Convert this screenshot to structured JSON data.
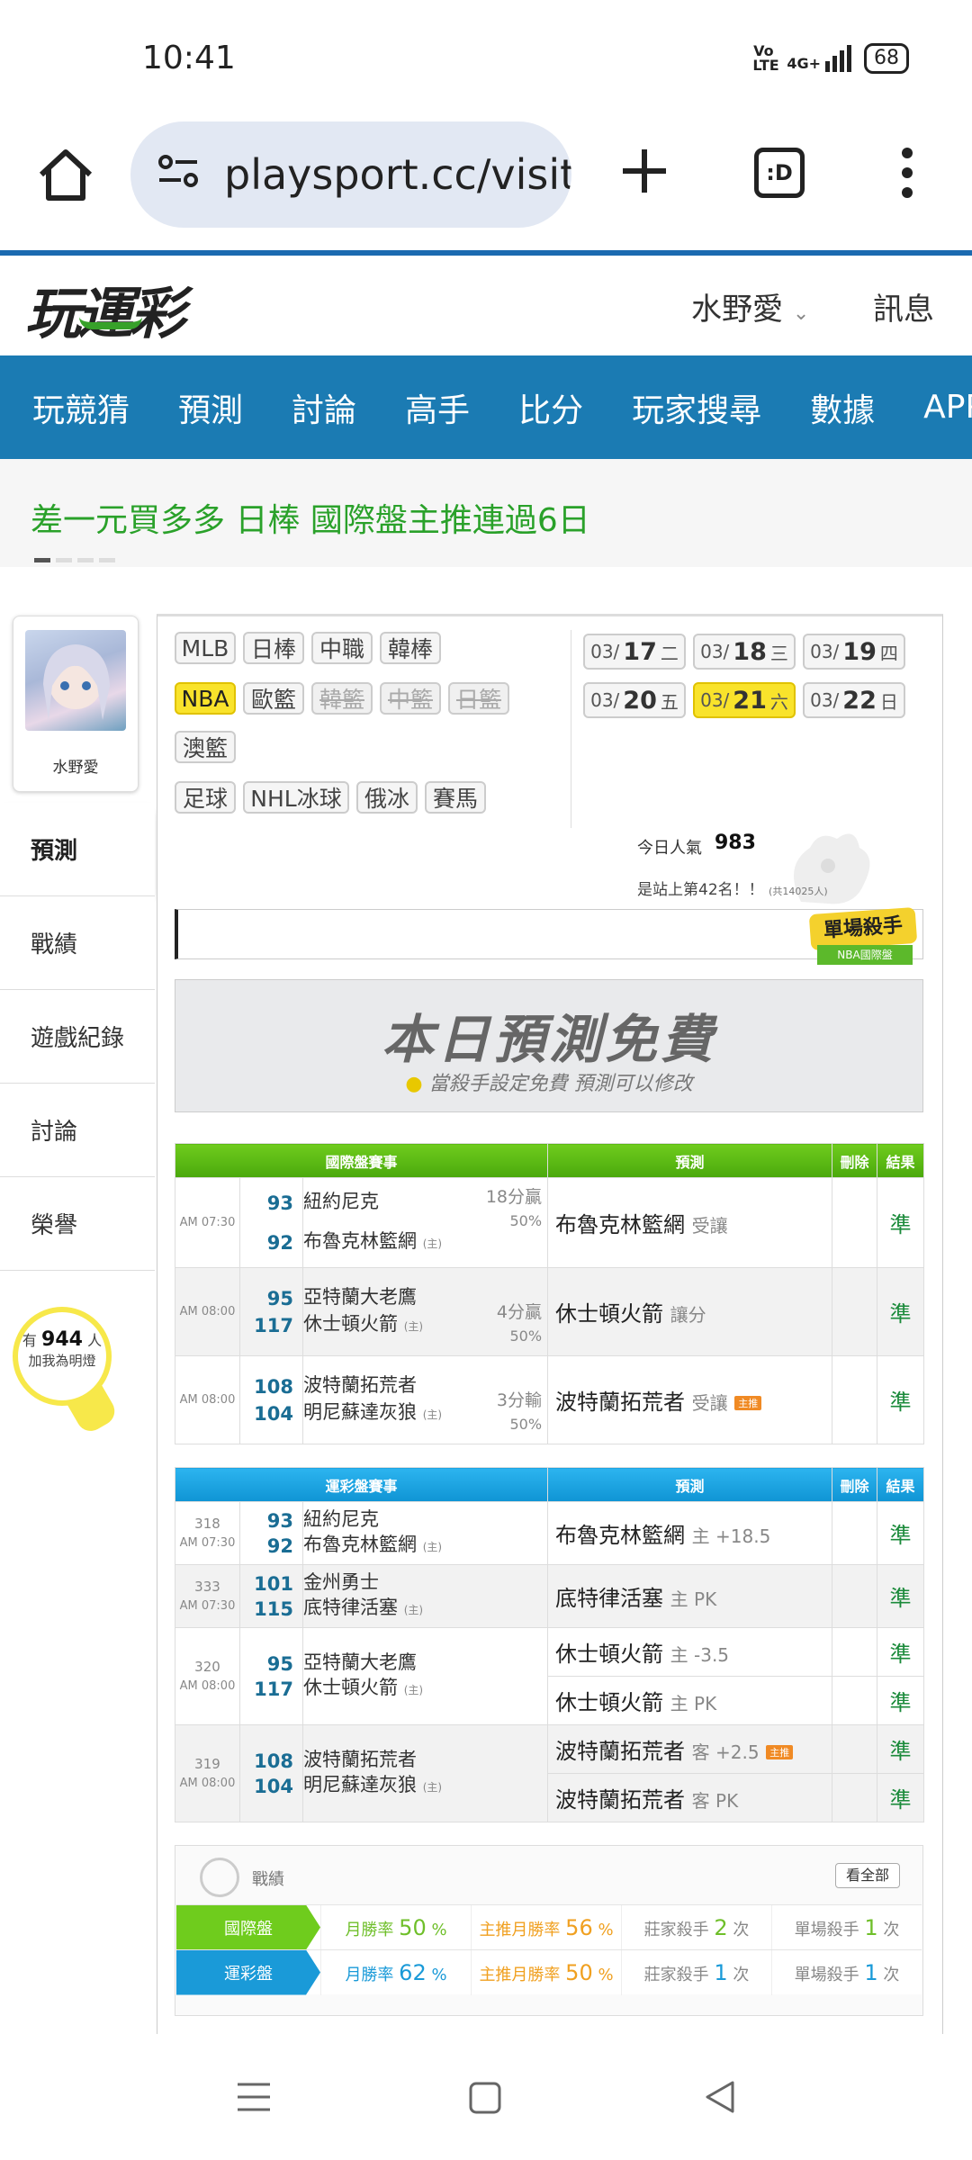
{
  "status_bar": {
    "time": "10:41",
    "volte": "Vo LTE",
    "network": "4G+",
    "battery": "68"
  },
  "browser": {
    "url": "playsport.cc/visit",
    "tabs_label": ":D"
  },
  "site": {
    "logo": "玩運彩",
    "user_name": "水野愛",
    "messages": "訊息",
    "nav": [
      "玩競猜",
      "預測",
      "討論",
      "高手",
      "比分",
      "玩家搜尋",
      "數據",
      "APP"
    ],
    "ticker": "差一元買多多 日棒 國際盤主推連過6日"
  },
  "sidebar": {
    "name": "水野愛",
    "items": [
      "預測",
      "戰績",
      "遊戲紀錄",
      "討論",
      "榮譽"
    ],
    "bulb": {
      "prefix": "有",
      "count": "944",
      "suffix": "人",
      "line2": "加我為明燈"
    }
  },
  "leagues": {
    "row1": [
      "MLB",
      "日棒",
      "中職",
      "韓棒"
    ],
    "row2": [
      "NBA",
      "歐籃",
      "韓籃",
      "中籃",
      "日籃"
    ],
    "row3": [
      "澳籃"
    ],
    "row4": [
      "足球",
      "NHL冰球",
      "俄冰",
      "賽馬"
    ]
  },
  "dates": [
    {
      "m": "03/",
      "d": "17",
      "w": "二"
    },
    {
      "m": "03/",
      "d": "18",
      "w": "三"
    },
    {
      "m": "03/",
      "d": "19",
      "w": "四"
    },
    {
      "m": "03/",
      "d": "20",
      "w": "五"
    },
    {
      "m": "03/",
      "d": "21",
      "w": "六"
    },
    {
      "m": "03/",
      "d": "22",
      "w": "日"
    }
  ],
  "popularity": {
    "label": "今日人氣",
    "value": "983",
    "rank": "是站上第42名！！",
    "rank_sub": "(共14025人)"
  },
  "killer_badge": {
    "title": "單場殺手",
    "sub": "NBA國際盤"
  },
  "banner": {
    "title": "本日預測免費",
    "sub": "當殺手設定免費 預測可以修改"
  },
  "intl_table": {
    "headers": [
      "國際盤賽事",
      "預測",
      "刪除",
      "結果"
    ],
    "rows": [
      {
        "time": "AM 07:30",
        "away_num": "93",
        "away": "紐約尼克",
        "home_num": "92",
        "home": "布魯克林籃網",
        "spread": "18分贏",
        "pct": "50%",
        "pred": "布魯克林籃網",
        "pred_note": "受讓",
        "result": "準"
      },
      {
        "time": "AM 08:00",
        "away_num": "95",
        "away": "亞特蘭大老鷹",
        "home_num": "117",
        "home": "休士頓火箭",
        "spread": "4分贏",
        "pct": "50%",
        "pred": "休士頓火箭",
        "pred_note": "讓分",
        "result": "準"
      },
      {
        "time": "AM 08:00",
        "away_num": "108",
        "away": "波特蘭拓荒者",
        "home_num": "104",
        "home": "明尼蘇達灰狼",
        "spread": "3分輸",
        "pct": "50%",
        "pred": "波特蘭拓荒者",
        "pred_note": "受讓",
        "tag": "主推",
        "result": "準"
      }
    ]
  },
  "lottery_table": {
    "headers": [
      "運彩盤賽事",
      "預測",
      "刪除",
      "結果"
    ],
    "home_mark": "(主)",
    "rows": [
      {
        "id": "318",
        "time": "AM 07:30",
        "away_num": "93",
        "away": "紐約尼克",
        "home_num": "92",
        "home": "布魯克林籃網",
        "preds": [
          {
            "team": "布魯克林籃網",
            "note": "主 +18.5",
            "result": "準"
          }
        ]
      },
      {
        "id": "333",
        "time": "AM 07:30",
        "away_num": "101",
        "away": "金州勇士",
        "home_num": "115",
        "home": "底特律活塞",
        "preds": [
          {
            "team": "底特律活塞",
            "note": "主 PK",
            "result": "準"
          }
        ]
      },
      {
        "id": "320",
        "time": "AM 08:00",
        "away_num": "95",
        "away": "亞特蘭大老鷹",
        "home_num": "117",
        "home": "休士頓火箭",
        "preds": [
          {
            "team": "休士頓火箭",
            "note": "主 -3.5",
            "result": "準"
          },
          {
            "team": "休士頓火箭",
            "note": "主 PK",
            "result": "準"
          }
        ]
      },
      {
        "id": "319",
        "time": "AM 08:00",
        "away_num": "108",
        "away": "波特蘭拓荒者",
        "home_num": "104",
        "home": "明尼蘇達灰狼",
        "preds": [
          {
            "team": "波特蘭拓荒者",
            "note": "客 +2.5",
            "tag": "主推",
            "result": "準"
          },
          {
            "team": "波特蘭拓荒者",
            "note": "客 PK",
            "result": "準"
          }
        ]
      }
    ]
  },
  "record": {
    "title": "戰績",
    "view_all": "看全部",
    "rows": [
      {
        "tag": "國際盤",
        "color": "#6fcc1d",
        "monthly_label": "月勝率",
        "monthly": "50",
        "main_label": "主推月勝率",
        "main": "56",
        "dealer_label": "莊家殺手",
        "dealer": "2",
        "single_label": "單場殺手",
        "single": "1",
        "unit_pct": "%",
        "unit_times": "次"
      },
      {
        "tag": "運彩盤",
        "color": "#1a9ad8",
        "monthly_label": "月勝率",
        "monthly": "62",
        "main_label": "主推月勝率",
        "main": "50",
        "dealer_label": "莊家殺手",
        "dealer": "1",
        "single_label": "單場殺手",
        "single": "1",
        "unit_pct": "%",
        "unit_times": "次"
      }
    ]
  }
}
